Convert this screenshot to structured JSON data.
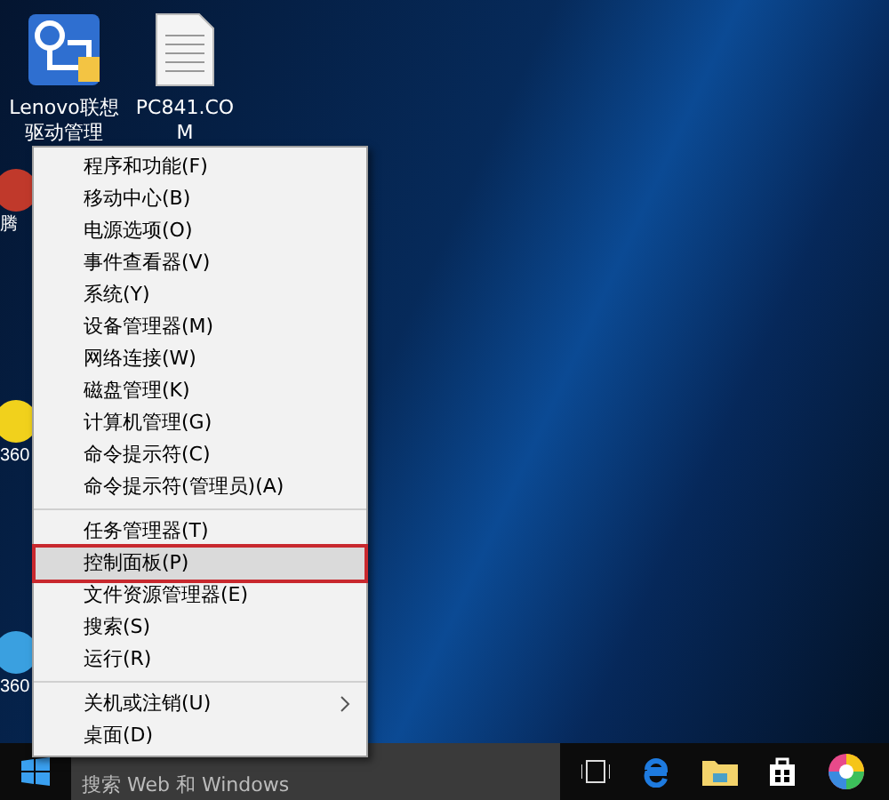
{
  "desktop_icons": [
    {
      "label": "Lenovo联想驱动管理",
      "kind": "app"
    },
    {
      "label": "PC841.COM",
      "kind": "file"
    }
  ],
  "left_icons": [
    {
      "label": "腾",
      "kind": "shield"
    },
    {
      "label": "360",
      "kind": "ball"
    },
    {
      "label": "360",
      "kind": "browser"
    }
  ],
  "context_menu": {
    "groups": [
      [
        {
          "label": "程序和功能(F)",
          "kind": "item",
          "selected": false
        },
        {
          "label": "移动中心(B)",
          "kind": "item",
          "selected": false
        },
        {
          "label": "电源选项(O)",
          "kind": "item",
          "selected": false
        },
        {
          "label": "事件查看器(V)",
          "kind": "item",
          "selected": false
        },
        {
          "label": "系统(Y)",
          "kind": "item",
          "selected": false
        },
        {
          "label": "设备管理器(M)",
          "kind": "item",
          "selected": false
        },
        {
          "label": "网络连接(W)",
          "kind": "item",
          "selected": false
        },
        {
          "label": "磁盘管理(K)",
          "kind": "item",
          "selected": false
        },
        {
          "label": "计算机管理(G)",
          "kind": "item",
          "selected": false
        },
        {
          "label": "命令提示符(C)",
          "kind": "item",
          "selected": false
        },
        {
          "label": "命令提示符(管理员)(A)",
          "kind": "item",
          "selected": false
        }
      ],
      [
        {
          "label": "任务管理器(T)",
          "kind": "item",
          "selected": false
        },
        {
          "label": "控制面板(P)",
          "kind": "item",
          "selected": true
        },
        {
          "label": "文件资源管理器(E)",
          "kind": "item",
          "selected": false
        },
        {
          "label": "搜索(S)",
          "kind": "item",
          "selected": false
        },
        {
          "label": "运行(R)",
          "kind": "item",
          "selected": false
        }
      ],
      [
        {
          "label": "关机或注销(U)",
          "kind": "submenu",
          "selected": false
        },
        {
          "label": "桌面(D)",
          "kind": "item",
          "selected": false
        }
      ]
    ]
  },
  "taskbar": {
    "search": {
      "placeholder": "搜索 Web 和 Windows"
    }
  }
}
